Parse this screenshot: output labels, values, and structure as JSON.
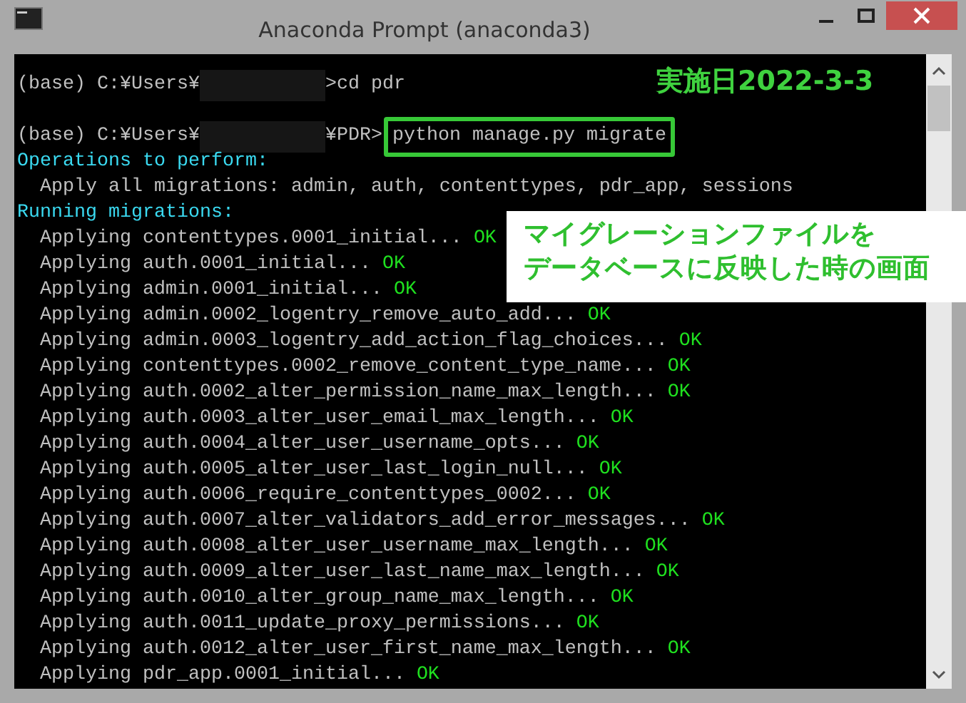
{
  "window": {
    "title": "Anaconda Prompt (anaconda3)"
  },
  "terminal": {
    "lines": [
      {
        "kind": "prompt",
        "prefix": "(base) C:¥Users¥",
        "redacted": true,
        "suffix": ">cd pdr"
      },
      {
        "kind": "blank"
      },
      {
        "kind": "prompt",
        "prefix": "(base) C:¥Users¥",
        "redacted": true,
        "suffix": "¥PDR>",
        "command": "python manage.py migrate",
        "highlighted": true
      },
      {
        "kind": "header",
        "text": "Operations to perform:"
      },
      {
        "kind": "text",
        "text": "  Apply all migrations: admin, auth, contenttypes, pdr_app, sessions"
      },
      {
        "kind": "header",
        "text": "Running migrations:"
      },
      {
        "kind": "apply",
        "text": "  Applying contenttypes.0001_initial...",
        "status": "OK"
      },
      {
        "kind": "apply",
        "text": "  Applying auth.0001_initial...",
        "status": "OK"
      },
      {
        "kind": "apply",
        "text": "  Applying admin.0001_initial...",
        "status": "OK"
      },
      {
        "kind": "apply",
        "text": "  Applying admin.0002_logentry_remove_auto_add...",
        "status": "OK"
      },
      {
        "kind": "apply",
        "text": "  Applying admin.0003_logentry_add_action_flag_choices...",
        "status": "OK"
      },
      {
        "kind": "apply",
        "text": "  Applying contenttypes.0002_remove_content_type_name...",
        "status": "OK"
      },
      {
        "kind": "apply",
        "text": "  Applying auth.0002_alter_permission_name_max_length...",
        "status": "OK"
      },
      {
        "kind": "apply",
        "text": "  Applying auth.0003_alter_user_email_max_length...",
        "status": "OK"
      },
      {
        "kind": "apply",
        "text": "  Applying auth.0004_alter_user_username_opts...",
        "status": "OK"
      },
      {
        "kind": "apply",
        "text": "  Applying auth.0005_alter_user_last_login_null...",
        "status": "OK"
      },
      {
        "kind": "apply",
        "text": "  Applying auth.0006_require_contenttypes_0002...",
        "status": "OK"
      },
      {
        "kind": "apply",
        "text": "  Applying auth.0007_alter_validators_add_error_messages...",
        "status": "OK"
      },
      {
        "kind": "apply",
        "text": "  Applying auth.0008_alter_user_username_max_length...",
        "status": "OK"
      },
      {
        "kind": "apply",
        "text": "  Applying auth.0009_alter_user_last_name_max_length...",
        "status": "OK"
      },
      {
        "kind": "apply",
        "text": "  Applying auth.0010_alter_group_name_max_length...",
        "status": "OK"
      },
      {
        "kind": "apply",
        "text": "  Applying auth.0011_update_proxy_permissions...",
        "status": "OK"
      },
      {
        "kind": "apply",
        "text": "  Applying auth.0012_alter_user_first_name_max_length...",
        "status": "OK"
      },
      {
        "kind": "apply",
        "text": "  Applying pdr_app.0001_initial...",
        "status": "OK"
      }
    ]
  },
  "annotations": {
    "date_label": "実施日2022-3-3",
    "callout": [
      "マイグレーションファイルを",
      "データベースに反映した時の画面"
    ]
  }
}
